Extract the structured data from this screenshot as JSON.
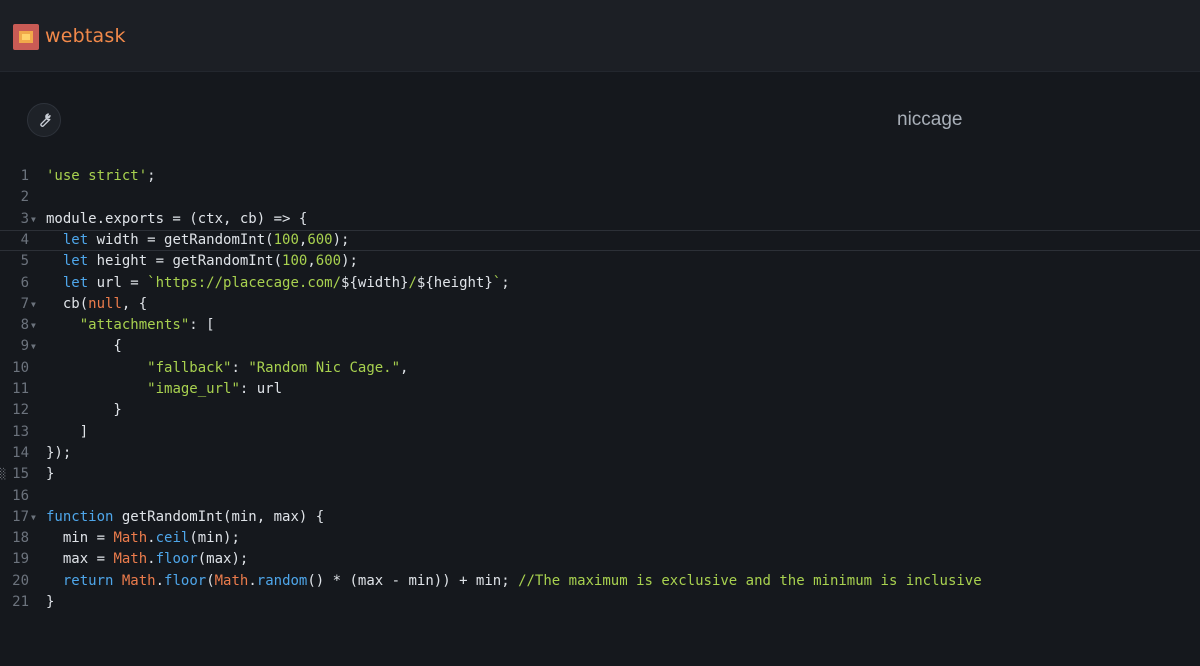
{
  "app": {
    "name": "webtask"
  },
  "task": {
    "name": "niccage"
  },
  "editor": {
    "lines": [
      {
        "n": "1",
        "fold": false,
        "tokens": [
          [
            "str",
            "'use strict'"
          ],
          [
            "plain",
            ";"
          ]
        ]
      },
      {
        "n": "2",
        "fold": false,
        "tokens": []
      },
      {
        "n": "3",
        "fold": true,
        "tokens": [
          [
            "plain",
            "module.exports = (ctx, cb) => {"
          ]
        ]
      },
      {
        "n": "4",
        "fold": false,
        "active": true,
        "tokens": [
          [
            "plain",
            "  "
          ],
          [
            "kw",
            "let"
          ],
          [
            "plain",
            " width = getRandomInt("
          ],
          [
            "num",
            "100"
          ],
          [
            "plain",
            ","
          ],
          [
            "num",
            "600"
          ],
          [
            "plain",
            ");"
          ]
        ]
      },
      {
        "n": "5",
        "fold": false,
        "tokens": [
          [
            "plain",
            "  "
          ],
          [
            "kw",
            "let"
          ],
          [
            "plain",
            " height = getRandomInt("
          ],
          [
            "num",
            "100"
          ],
          [
            "plain",
            ","
          ],
          [
            "num",
            "600"
          ],
          [
            "plain",
            ");"
          ]
        ]
      },
      {
        "n": "6",
        "fold": false,
        "tokens": [
          [
            "plain",
            "  "
          ],
          [
            "kw",
            "let"
          ],
          [
            "plain",
            " url = "
          ],
          [
            "str",
            "`https://placecage.com/"
          ],
          [
            "plain",
            "${width}"
          ],
          [
            "str",
            "/"
          ],
          [
            "plain",
            "${height}"
          ],
          [
            "str",
            "`"
          ],
          [
            "plain",
            ";"
          ]
        ]
      },
      {
        "n": "7",
        "fold": true,
        "tokens": [
          [
            "plain",
            "  cb("
          ],
          [
            "nul",
            "null"
          ],
          [
            "plain",
            ", {"
          ]
        ]
      },
      {
        "n": "8",
        "fold": true,
        "tokens": [
          [
            "plain",
            "    "
          ],
          [
            "str",
            "\"attachments\""
          ],
          [
            "plain",
            ": ["
          ]
        ]
      },
      {
        "n": "9",
        "fold": true,
        "tokens": [
          [
            "plain",
            "        {"
          ]
        ]
      },
      {
        "n": "10",
        "fold": false,
        "tokens": [
          [
            "plain",
            "            "
          ],
          [
            "str",
            "\"fallback\""
          ],
          [
            "plain",
            ": "
          ],
          [
            "str",
            "\"Random Nic Cage.\""
          ],
          [
            "plain",
            ","
          ]
        ]
      },
      {
        "n": "11",
        "fold": false,
        "tokens": [
          [
            "plain",
            "            "
          ],
          [
            "str",
            "\"image_url\""
          ],
          [
            "plain",
            ": url"
          ]
        ]
      },
      {
        "n": "12",
        "fold": false,
        "tokens": [
          [
            "plain",
            "        }"
          ]
        ]
      },
      {
        "n": "13",
        "fold": false,
        "tokens": [
          [
            "plain",
            "    ]"
          ]
        ]
      },
      {
        "n": "14",
        "fold": false,
        "tokens": [
          [
            "plain",
            "});"
          ]
        ]
      },
      {
        "n": "15",
        "fold": false,
        "marker": true,
        "tokens": [
          [
            "plain",
            "}"
          ]
        ]
      },
      {
        "n": "16",
        "fold": false,
        "tokens": []
      },
      {
        "n": "17",
        "fold": true,
        "tokens": [
          [
            "kw",
            "function"
          ],
          [
            "plain",
            " getRandomInt(min, max) {"
          ]
        ]
      },
      {
        "n": "18",
        "fold": false,
        "tokens": [
          [
            "plain",
            "  min = "
          ],
          [
            "fn",
            "Math"
          ],
          [
            "plain",
            "."
          ],
          [
            "kw",
            "ceil"
          ],
          [
            "plain",
            "(min);"
          ]
        ]
      },
      {
        "n": "19",
        "fold": false,
        "tokens": [
          [
            "plain",
            "  max = "
          ],
          [
            "fn",
            "Math"
          ],
          [
            "plain",
            "."
          ],
          [
            "kw",
            "floor"
          ],
          [
            "plain",
            "(max);"
          ]
        ]
      },
      {
        "n": "20",
        "fold": false,
        "tokens": [
          [
            "plain",
            "  "
          ],
          [
            "kw",
            "return"
          ],
          [
            "plain",
            " "
          ],
          [
            "fn",
            "Math"
          ],
          [
            "plain",
            "."
          ],
          [
            "kw",
            "floor"
          ],
          [
            "plain",
            "("
          ],
          [
            "fn",
            "Math"
          ],
          [
            "plain",
            "."
          ],
          [
            "kw",
            "random"
          ],
          [
            "plain",
            "() * (max - min)) + min; "
          ],
          [
            "cm",
            "//The maximum is exclusive and the minimum is inclusive"
          ]
        ]
      },
      {
        "n": "21",
        "fold": false,
        "tokens": [
          [
            "plain",
            "}"
          ]
        ]
      }
    ]
  },
  "icons": {
    "logo": "webtask-logo-icon",
    "settings": "wrench-icon",
    "fold": "fold-arrow-icon"
  },
  "colors": {
    "background": "#15181d",
    "topbar": "#1c1f25",
    "brand": "#f2894a",
    "string": "#a8d14f",
    "keyword": "#4ea6ea",
    "builtin": "#ec7c4c"
  }
}
